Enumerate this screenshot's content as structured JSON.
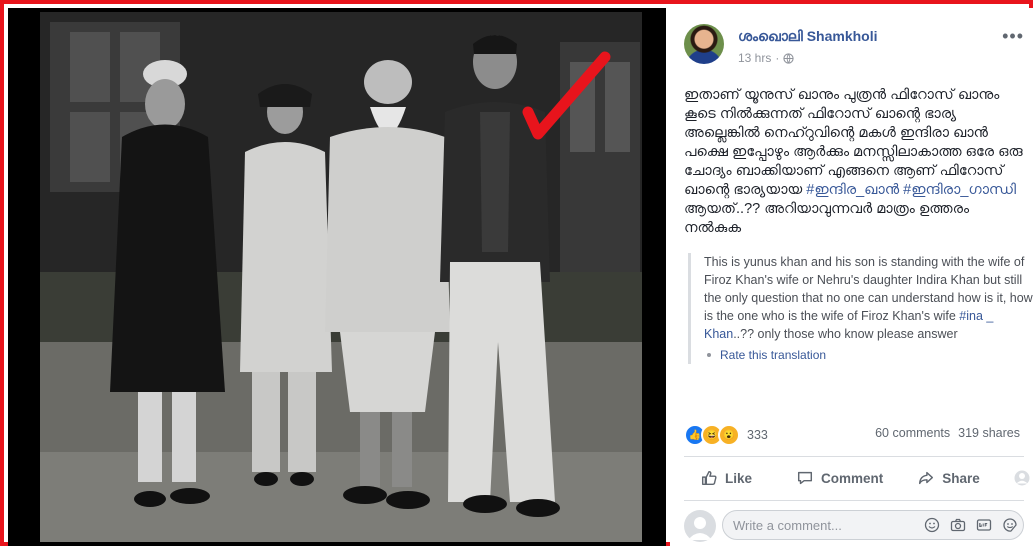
{
  "post": {
    "author": "ശംഖൊലി Shamkholi",
    "timestamp": "13 hrs",
    "text_parts": [
      "ഇതാണ് യൂനുസ് ഖാനും പുത്രൻ ഫിറോസ് ഖാനും കൂടെ നിൽക്കുന്നത് ഫിറോസ് ഖാന്റെ ഭാര്യ അല്ലെങ്കിൽ നെഹ്റുവിന്റെ മകൾ ഇന്ദിരാ ഖാൻ പക്ഷെ ഇപ്പോഴും ആർക്കും മനസ്സിലാകാത്ത ഒരേ ഒരു ചോദ്യം ബാക്കിയാണ് എങ്ങനെ ആണ് ഫിറോസ് ഖാന്റെ ഭാര്യയായ ",
      "#ഇന്ദിര_ഖാൻ",
      " ",
      "#ഇന്ദിരാ_ഗാന്ധി",
      " ആയത്..?? അറിയാവുന്നവർ മാത്രം ഉത്തരം നൽകുക"
    ],
    "translation_parts": [
      "This is yunus khan and his son is standing with the wife of Firoz Khan's wife or Nehru's daughter Indira Khan but still the only question that no one can understand how is it, how is the one who is the wife of Firoz Khan's wife ",
      "#ina _ Khan",
      "..?? only those who know please answer"
    ],
    "rate_translation": "Rate this translation"
  },
  "stats": {
    "reaction_count": "333",
    "comments": "60 comments",
    "shares": "319 shares"
  },
  "actions": {
    "like": "Like",
    "comment": "Comment",
    "share": "Share"
  },
  "comment_box": {
    "placeholder": "Write a comment..."
  },
  "colors": {
    "frame_border": "#e8141c",
    "link_blue": "#385898",
    "checkmark": "#e8141c"
  }
}
